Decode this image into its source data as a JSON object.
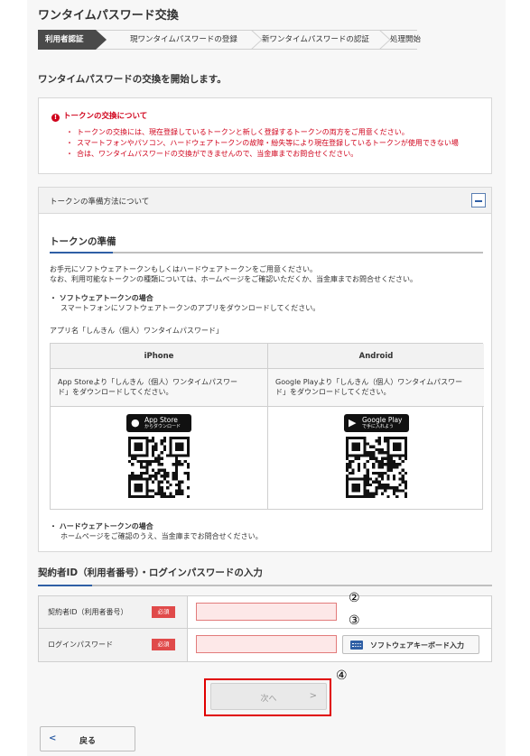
{
  "page": {
    "title": "ワンタイムパスワード交換"
  },
  "steps": [
    {
      "label": "利用者認証"
    },
    {
      "label": "現ワンタイムパスワードの登録"
    },
    {
      "label": "新ワンタイムパスワードの認証"
    },
    {
      "label": "処理開始"
    }
  ],
  "lead": "ワンタイムパスワードの交換を開始します。",
  "notice": {
    "title": "トークンの交換について",
    "icon": "exclamation-circle-icon",
    "items": [
      "トークンの交換には、現在登録しているトークンと新しく登録するトークンの両方をご用意ください。",
      "スマートフォンやパソコン、ハードウェアトークンの故障・紛失等により現在登録しているトークンが使用できない場",
      "合は、ワンタイムパスワードの交換ができませんので、当金庫までお問合せください。"
    ],
    "color": "#d0021b"
  },
  "accordion": {
    "header": "トークンの準備方法について",
    "section_title": "トークンの準備",
    "intro_1": "お手元にソフトウェアトークンもしくはハードウェアトークンをご用意ください。",
    "intro_2": "なお、利用可能なトークンの種類については、ホームページをご確認いただくか、当金庫までお問合せください。",
    "software_title": "・ ソフトウェアトークンの場合",
    "software_desc": "スマートフォンにソフトウェアトークンのアプリをダウンロードしてください。",
    "app_name": "アプリ名「しんきん（個人）ワンタイムパスワード」",
    "apps": [
      {
        "platform": "iPhone",
        "desc_1": "App Storeより「しんきん（個人）ワンタイムパスワー",
        "desc_2": "ド」をダウンロードしてください。",
        "badge_name": "App Store",
        "badge_sub": "からダウンロード",
        "badge_icon": "apple-icon"
      },
      {
        "platform": "Android",
        "desc_1": "Google Playより「しんきん（個人）ワンタイムパスワー",
        "desc_2": "ド」をダウンロードしてください。",
        "badge_name": "Google Play",
        "badge_sub": "で手に入れよう",
        "badge_icon": "google-play-icon"
      }
    ],
    "hardware_title": "・ ハードウェアトークンの場合",
    "hardware_desc": "ホームページをご確認のうえ、当金庫までお問合せください。"
  },
  "login": {
    "title": "契約者ID（利用者番号）・ログインパスワードの入力",
    "fields": [
      {
        "label": "契約者ID（利用者番号）",
        "required": "必須",
        "value": "",
        "placeholder": ""
      },
      {
        "label": "ログインパスワード",
        "required": "必須",
        "value": "",
        "placeholder": ""
      }
    ],
    "keyboard_button": "ソフトウェアキーボード入力"
  },
  "annotations": {
    "a2": "②",
    "a3": "③",
    "a4": "④"
  },
  "buttons": {
    "next": "次へ",
    "back": "戻る"
  },
  "colors": {
    "accent": "#2f5fa5",
    "required": "#e04a4a",
    "highlight": "#e00000"
  }
}
